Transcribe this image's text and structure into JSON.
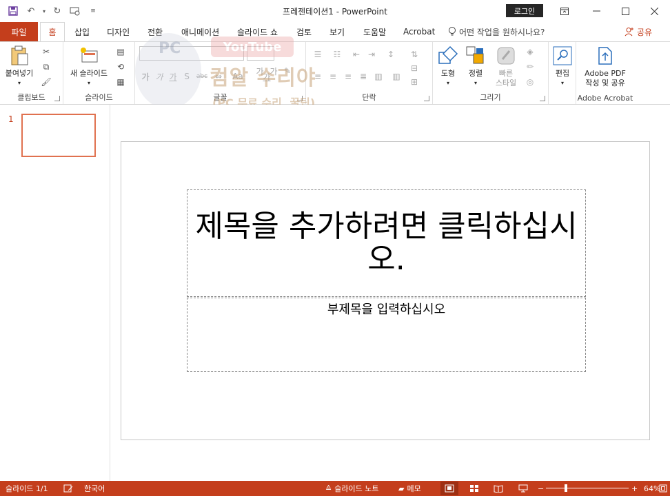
{
  "window": {
    "title": "프레젠테이션1  -  PowerPoint",
    "signin": "로그인"
  },
  "tabs": {
    "file": "파일",
    "home": "홈",
    "insert": "삽입",
    "design": "디자인",
    "transitions": "전환",
    "animations": "애니메이션",
    "slideshow": "슬라이드 쇼",
    "review": "검토",
    "view": "보기",
    "help": "도움말",
    "acrobat": "Acrobat",
    "tell_me": "어떤 작업을 원하시나요?",
    "share": "공유"
  },
  "ribbon": {
    "clipboard": {
      "label": "클립보드",
      "paste": "붙여넣기"
    },
    "slides": {
      "label": "슬라이드",
      "new_slide": "새 슬라이드"
    },
    "font": {
      "label": "글꼴",
      "grow": "가",
      "shrink": "가",
      "bold": "가",
      "italic": "가",
      "underline": "가",
      "strike": "abc",
      "aa": "Aa",
      "color": "가"
    },
    "paragraph": {
      "label": "단락"
    },
    "drawing": {
      "label": "그리기",
      "shapes": "도형",
      "arrange": "정렬",
      "quick_styles_1": "빠른",
      "quick_styles_2": "스타일"
    },
    "editing": {
      "label": "편집"
    },
    "adobe": {
      "label": "Adobe Acrobat",
      "pdf_1": "Adobe PDF",
      "pdf_2": "작성 및 공유"
    }
  },
  "watermark": {
    "pc": "PC",
    "youtube": "YouTube",
    "main": "컴알 수리야",
    "sub": "(PC 무료 수리, 꿀팁)"
  },
  "thumbnails": [
    {
      "number": "1"
    }
  ],
  "slide": {
    "title_placeholder": "제목을 추가하려면 클릭하십시오.",
    "subtitle_placeholder": "부제목을 입력하십시오"
  },
  "status": {
    "slide_count": "슬라이드 1/1",
    "language": "한국어",
    "notes": "슬라이드 노트",
    "comments": "메모",
    "zoom": "64%"
  },
  "colors": {
    "accent": "#c43e1c",
    "status_bg": "#c43e1c"
  }
}
